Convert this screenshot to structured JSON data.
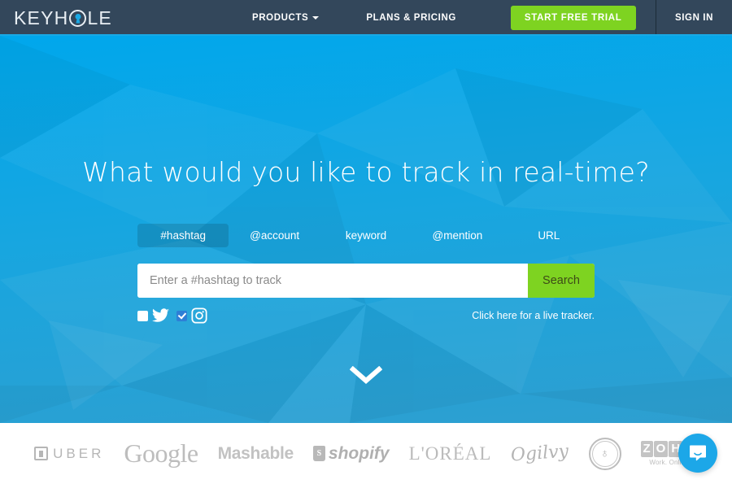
{
  "navbar": {
    "logo_text_before": "KEYH",
    "logo_text_after": "LE",
    "logo_icon": "keyhole-icon",
    "links": [
      {
        "label": "PRODUCTS",
        "has_caret": true
      },
      {
        "label": "PLANS & PRICING",
        "has_caret": false
      }
    ],
    "cta_label": "START FREE TRIAL",
    "signin_label": "SIGN IN",
    "background_color": "#33475b",
    "accent_line_color": "#19a9e5",
    "cta_color": "#7ed321"
  },
  "hero": {
    "title": "What would you like to track in real-time?",
    "background_gradient_top": "#00a7ec",
    "background_gradient_bottom": "#2e9fd0",
    "tabs": [
      {
        "label": "#hashtag",
        "active": true
      },
      {
        "label": "@account",
        "active": false
      },
      {
        "label": "keyword",
        "active": false
      },
      {
        "label": "@mention",
        "active": false
      },
      {
        "label": "URL",
        "active": false
      }
    ],
    "search": {
      "value": "",
      "placeholder": "Enter a #hashtag to track",
      "button_label": "Search",
      "button_color": "#7ed321"
    },
    "channels": [
      {
        "name": "twitter",
        "icon": "twitter-icon",
        "checked": false
      },
      {
        "name": "instagram",
        "icon": "instagram-icon",
        "checked": true
      }
    ],
    "tracker_link": "Click here for a live tracker.",
    "scroll_icon": "chevron-down-icon"
  },
  "clients": {
    "logos": [
      {
        "name": "uber",
        "label": "UBER"
      },
      {
        "name": "google",
        "label": "Google"
      },
      {
        "name": "mashable",
        "label": "Mashable"
      },
      {
        "name": "shopify",
        "label": "shopify",
        "mark": "S"
      },
      {
        "name": "loreal",
        "label": "L'ORÉAL"
      },
      {
        "name": "ogilvy",
        "label": "Ogilvy"
      },
      {
        "name": "government-seal",
        "label": "",
        "glyph": "♁"
      },
      {
        "name": "zoho",
        "letters": [
          "Z",
          "O",
          "H",
          "O"
        ],
        "tagline": "Work. Online"
      }
    ]
  },
  "chat": {
    "icon": "chat-bubble-icon",
    "color": "#1ca7e8"
  }
}
